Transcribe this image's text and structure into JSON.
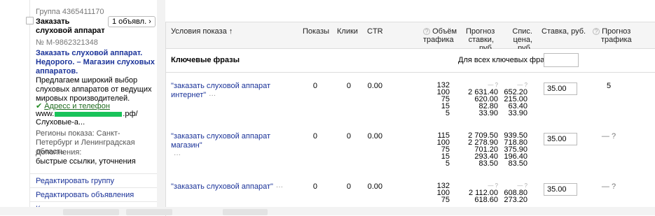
{
  "group": {
    "label": "Группа 4365411170"
  },
  "ad": {
    "title": "Заказать слуховой аппарат",
    "count_badge": "1 объявл. ›",
    "number": "№ М-9862321348",
    "headline": "Заказать слуховой аппарат. Недорого. – Магазин слуховых аппаратов.",
    "text": "Предлагаем широкий выбор слуховых аппаратов от ведущих мировых производителей.",
    "address_link": "Адресс и телефон",
    "url_prefix": "www.",
    "url_suffix": ".рф/",
    "url_path": "Слуховые-а...",
    "regions": "Регионы показа: Санкт-Петербург и Ленинградская область",
    "extras_label": "Дополнения:",
    "extras_value": "быстрые ссылки, уточнения"
  },
  "menu": [
    {
      "label": "Редактировать группу"
    },
    {
      "label": "Редактировать объявления"
    },
    {
      "label": "Копировать группу"
    }
  ],
  "table": {
    "headers": {
      "conditions": "Условия показа ↑",
      "impressions": "Показы",
      "clicks": "Клики",
      "ctr": "CTR",
      "volume_l1": "Объём",
      "volume_l2": "трафика",
      "forecast_l1": "Прогноз",
      "forecast_l2": "ставки, руб.",
      "spend_l1": "Спис.",
      "spend_l2": "цена, руб.",
      "bid": "Ставка, руб.",
      "traffic_l1": "Прогноз",
      "traffic_l2": "трафика"
    },
    "keyword_section": "Ключевые фразы",
    "all_phrases_label": "Для всех ключевых фраз:",
    "rows": [
      {
        "phrase": "\"заказать слуховой аппарат интернет\"",
        "impressions": "0",
        "clicks": "0",
        "ctr": "0.00",
        "volume": [
          "132",
          "100",
          "75",
          "15",
          "5"
        ],
        "forecast": [
          "— ?",
          "2 631.40",
          "620.00",
          "82.80",
          "33.90"
        ],
        "spend": [
          "— ?",
          "652.20",
          "215.00",
          "63.40",
          "33.90"
        ],
        "bid": "35.00",
        "traffic_forecast": "5"
      },
      {
        "phrase": "\"заказать слуховой аппарат магазин\"",
        "impressions": "0",
        "clicks": "0",
        "ctr": "0.00",
        "volume": [
          "115",
          "100",
          "75",
          "15",
          "5"
        ],
        "forecast": [
          "2 709.50",
          "2 278.90",
          "701.20",
          "293.40",
          "83.50"
        ],
        "spend": [
          "939.50",
          "718.80",
          "375.90",
          "196.40",
          "83.50"
        ],
        "bid": "35.00",
        "traffic_forecast": "— ?"
      },
      {
        "phrase": "\"заказать слуховой аппарат\"",
        "impressions": "0",
        "clicks": "0",
        "ctr": "0.00",
        "volume": [
          "132",
          "100",
          "75"
        ],
        "forecast": [
          "— ?",
          "2 112.00",
          "618.60"
        ],
        "spend": [
          "— ?",
          "608.80",
          "273.20"
        ],
        "bid": "35.00",
        "traffic_forecast": "— ?"
      }
    ]
  }
}
